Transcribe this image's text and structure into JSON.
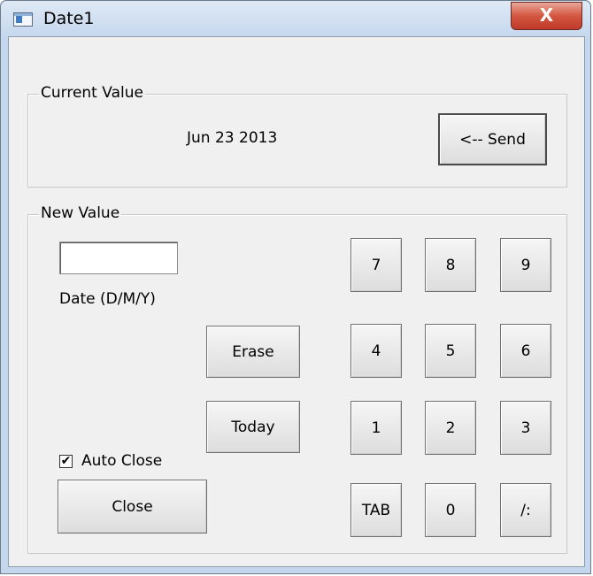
{
  "window": {
    "title": "Date1",
    "close_glyph": "X"
  },
  "current": {
    "legend": "Current Value",
    "value": "Jun 23 2013",
    "send_label": "<-- Send"
  },
  "new": {
    "legend": "New Value",
    "date_input_value": "",
    "date_format_label": "Date (D/M/Y)",
    "erase_label": "Erase",
    "today_label": "Today",
    "auto_close_label": "Auto Close",
    "auto_close_checked": "✔",
    "close_label": "Close",
    "keys": [
      "7",
      "8",
      "9",
      "4",
      "5",
      "6",
      "1",
      "2",
      "3",
      "TAB",
      "0",
      "/:"
    ]
  }
}
